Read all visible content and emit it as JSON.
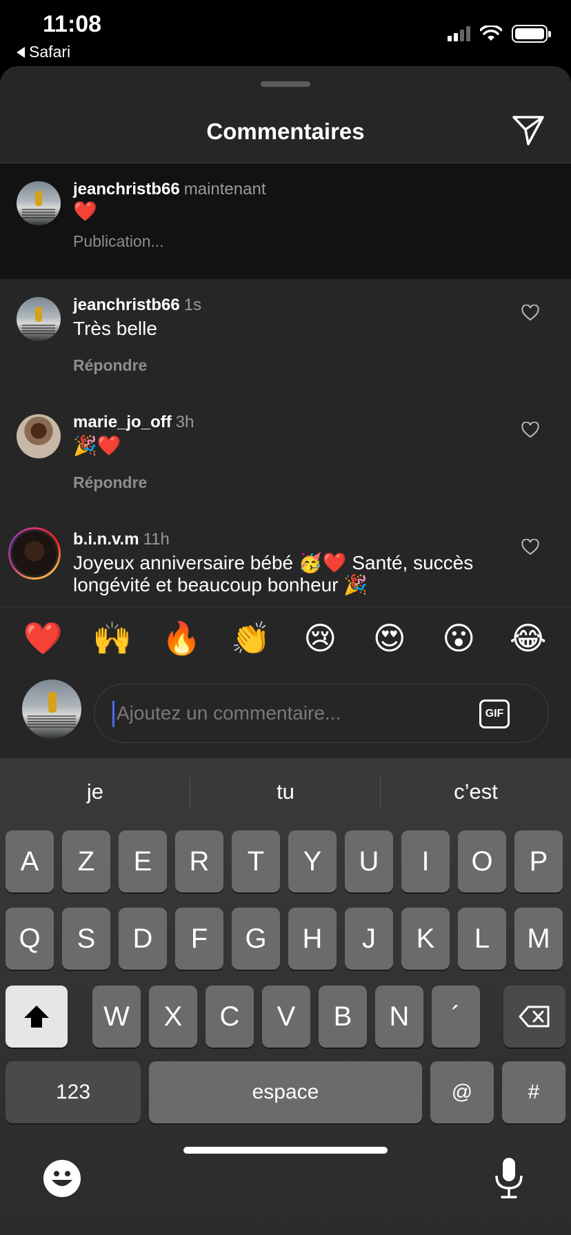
{
  "status_bar": {
    "time": "11:08",
    "back_app": "Safari"
  },
  "sheet": {
    "title": "Commentaires"
  },
  "pending_comment": {
    "username": "jeanchristb66",
    "time": "maintenant",
    "text": "❤️",
    "status": "Publication..."
  },
  "comments": [
    {
      "username": "jeanchristb66",
      "time": "1s",
      "text": "Très belle",
      "reply_label": "Répondre"
    },
    {
      "username": "marie_jo_off",
      "time": "3h",
      "text": "🎉❤️",
      "reply_label": "Répondre"
    },
    {
      "username": "b.i.n.v.m",
      "time": "11h",
      "text": "Joyeux anniversaire bébé 🥳❤️ Santé, succès longévité et beaucoup bonheur 🎉"
    }
  ],
  "quick_emojis": [
    "❤️",
    "🙌",
    "🔥",
    "👏",
    "😢",
    "😍",
    "😮",
    "😂"
  ],
  "composer": {
    "placeholder": "Ajoutez un commentaire...",
    "gif_label": "GIF"
  },
  "keyboard": {
    "suggestions": [
      "je",
      "tu",
      "c’est"
    ],
    "row1": [
      "A",
      "Z",
      "E",
      "R",
      "T",
      "Y",
      "U",
      "I",
      "O",
      "P"
    ],
    "row2": [
      "Q",
      "S",
      "D",
      "F",
      "G",
      "H",
      "J",
      "K",
      "L",
      "M"
    ],
    "row3": [
      "W",
      "X",
      "C",
      "V",
      "B",
      "N",
      "´"
    ],
    "numbers_label": "123",
    "space_label": "espace",
    "at_label": "@",
    "hash_label": "#"
  },
  "icons": {
    "send": "paper-plane-icon",
    "like": "heart-outline-icon",
    "shift": "shift-icon",
    "backspace": "backspace-icon",
    "emoji": "emoji-icon",
    "mic": "microphone-icon"
  }
}
